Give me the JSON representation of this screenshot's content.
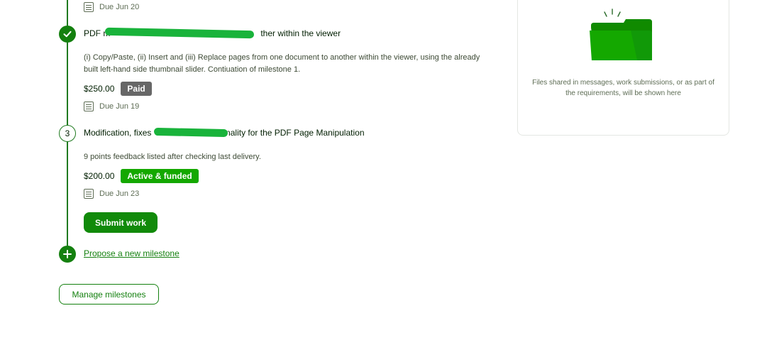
{
  "milestones": [
    {
      "due": "Due Jun 20"
    },
    {
      "state": "completed",
      "title_start": "PDF m",
      "title_end": "ther within the viewer",
      "description": "(i) Copy/Paste, (ii) Insert and (iii) Replace pages from one document to another within the viewer, using the already built left-hand side thumbnail slider. Contiuation of milestone 1.",
      "amount": "$250.00",
      "status": "Paid",
      "due": "Due Jun 19"
    },
    {
      "state": "active",
      "number": "3",
      "title_start": "Modification, fixes",
      "title_end": "onality for the PDF Page Manipulation",
      "description": "9 points feedback listed after checking last delivery.",
      "amount": "$200.00",
      "status": "Active & funded",
      "due": "Due Jun 23"
    }
  ],
  "actions": {
    "submit_work": "Submit work",
    "propose_milestone": "Propose a new milestone",
    "manage_milestones": "Manage milestones"
  },
  "files_panel": {
    "empty_text": "Files shared in messages, work submissions, or as part of the requirements, will be shown here",
    "icon": "folder-icon"
  },
  "colors": {
    "accent": "#14800f",
    "active_badge": "#14a800",
    "paid_badge": "#676767"
  }
}
